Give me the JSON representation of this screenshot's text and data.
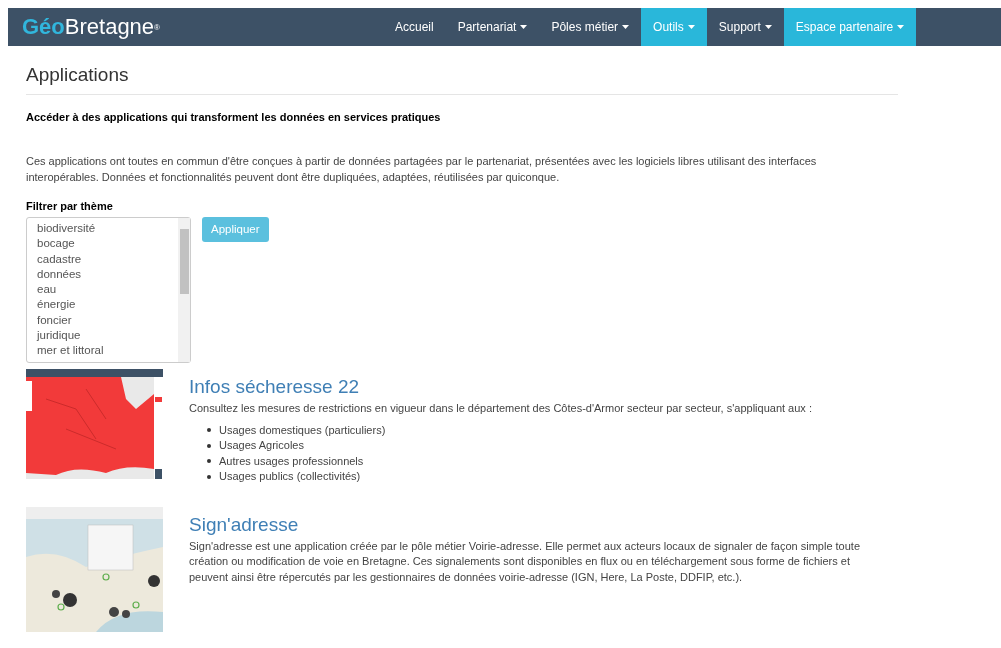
{
  "navbar": {
    "logo": {
      "accent": "Géo",
      "rest": "Bretagne",
      "mark": "®"
    },
    "items": [
      {
        "label": "Accueil",
        "has_menu": false,
        "selected": false
      },
      {
        "label": "Partenariat",
        "has_menu": true,
        "selected": false
      },
      {
        "label": "Pôles métier",
        "has_menu": true,
        "selected": false
      },
      {
        "label": "Outils",
        "has_menu": true,
        "selected": true
      },
      {
        "label": "Support",
        "has_menu": true,
        "selected": false
      },
      {
        "label": "Espace partenaire",
        "has_menu": true,
        "selected": true
      }
    ]
  },
  "page": {
    "title": "Applications",
    "subtitle": "Accéder à des applications qui transforment les données en services pratiques",
    "intro": "Ces applications ont toutes en commun d'être conçues à partir de données partagées par le partenariat, présentées avec les logiciels libres utilisant des interfaces interopérables. Données et fonctionnalités peuvent dont être dupliquées, adaptées, réutilisées par quiconque."
  },
  "filter": {
    "label": "Filtrer par thème",
    "options": [
      "biodiversité",
      "bocage",
      "cadastre",
      "données",
      "eau",
      "énergie",
      "foncier",
      "juridique",
      "mer et littoral"
    ],
    "button": "Appliquer"
  },
  "applications": [
    {
      "title": "Infos sécheresse 22",
      "description": "Consultez les mesures de restrictions en vigueur dans le département des Côtes-d'Armor secteur par secteur, s'appliquant aux :",
      "bullets": [
        "Usages domestiques (particuliers)",
        "Usages Agricoles",
        "Autres usages professionnels",
        "Usages publics (collectivités)"
      ]
    },
    {
      "title": "Sign'adresse",
      "description": "Sign'adresse est une application créée par le pôle métier Voirie-adresse. Elle permet aux acteurs locaux de signaler de façon simple toute création ou modification de voie en Bretagne. Ces signalements sont disponibles en flux ou en téléchargement sous forme de fichiers et peuvent ainsi être répercutés par les gestionnaires de données voirie-adresse (IGN, Here, La Poste, DDFIP, etc.)."
    }
  ]
}
